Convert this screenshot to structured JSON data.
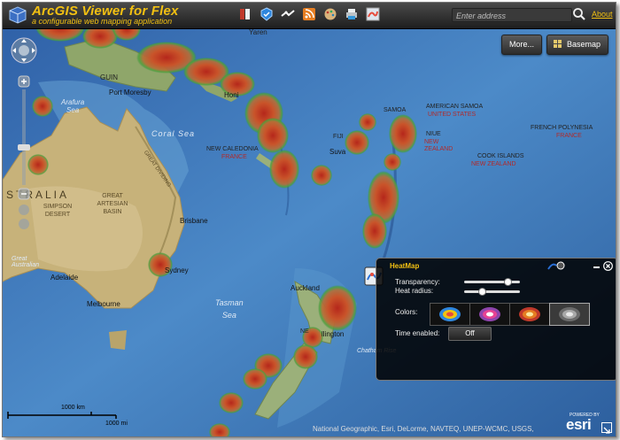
{
  "header": {
    "title": "ArcGIS Viewer for Flex",
    "subtitle": "a configurable web mapping application",
    "search_placeholder": "Enter address",
    "about_link": "About"
  },
  "toolbar": {
    "icons": [
      "layer-list-icon",
      "legend-icon",
      "draw-icon",
      "rss-icon",
      "theme-icon",
      "print-icon",
      "heatmap-icon"
    ]
  },
  "map_buttons": {
    "more": "More...",
    "basemap": "Basemap"
  },
  "map_labels": {
    "yaren": "Yaren",
    "port_moresby": "Port Moresby",
    "arafura_sea": "Arafura\nSea",
    "coral_sea": "Coral Sea",
    "new_caledonia": "NEW CALEDONIA",
    "new_caledonia_country": "FRANCE",
    "fiji": "FIJI",
    "suva": "Suva",
    "samoa": "SAMOA",
    "american_samoa": "AMERICAN SAMOA",
    "american_samoa_country": "UNITED STATES",
    "niue": "NIUE",
    "niue_country": "NEW ZEALAND",
    "cook_islands": "COOK ISLANDS",
    "cook_islands_country": "NEW ZEALAND",
    "french_polynesia": "FRENCH POLYNESIA",
    "french_polynesia_country": "FRANCE",
    "australia": "STRALIA",
    "great_artesian_basin": "GREAT ARTESIAN BASIN",
    "simpson_desert": "SIMPSON DESERT",
    "brisbane": "Brisbane",
    "sydney": "Sydney",
    "adelaide": "Adelaide",
    "melbourne": "Melbourne",
    "great_dividing": "GREAT DIVIDING",
    "tasman_sea": "Tasman\nSea",
    "auckland": "Auckland",
    "wellington": "llington",
    "new_zealand": "NE",
    "guinea": "GUIN",
    "honiara": "Honi",
    "chatham": "Chatham Rise",
    "great_australian_bight": "Great\nAustralian"
  },
  "heatmap_panel": {
    "title": "HeatMap",
    "transparency_label": "Transparency:",
    "transparency_value": 0.8,
    "heat_radius_label": "Heat radius:",
    "heat_radius_value": 0.28,
    "colors_label": "Colors:",
    "color_options": [
      "Classic",
      "Magenta",
      "Fire",
      "Grayscale"
    ],
    "selected_color": "Grayscale",
    "time_enabled_label": "Time enabled:",
    "time_enabled_value": "Off"
  },
  "scalebar": {
    "km_label": "1000 km",
    "mi_label": "1000 mi"
  },
  "attribution": "National Geographic, Esri, DeLorme, NAVTEQ, UNEP-WCMC, USGS,",
  "esri_logo": {
    "powered_by": "POWERED BY",
    "brand": "esri"
  },
  "colors": {
    "accent": "#f2c012",
    "ocean": "#3a73b6",
    "land": "#c9b67a",
    "heat_hot": "#c0331c",
    "heat_edge": "#4e9a3d"
  }
}
